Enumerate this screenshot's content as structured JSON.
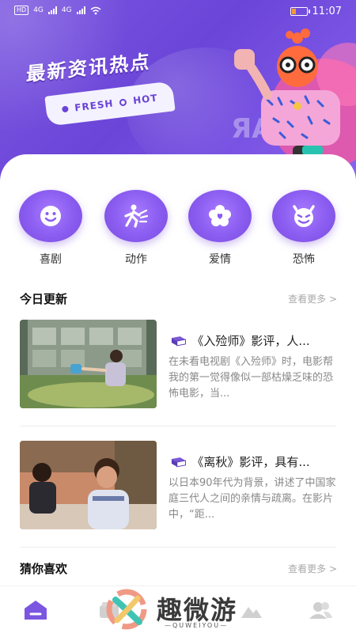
{
  "status_bar": {
    "hd_label": "HD",
    "network_a": "4G",
    "network_b": "4G",
    "time": "11:07"
  },
  "hero": {
    "title": "最新资讯热点",
    "tag_left": "FRESH",
    "tag_right": "HOT"
  },
  "categories": [
    {
      "label": "喜剧",
      "icon": "smile-icon"
    },
    {
      "label": "动作",
      "icon": "running-icon"
    },
    {
      "label": "爱情",
      "icon": "flower-heart-icon"
    },
    {
      "label": "恐怖",
      "icon": "devil-icon"
    }
  ],
  "today_section": {
    "title": "今日更新",
    "more": "查看更多 >"
  },
  "articles": [
    {
      "title": "《入殓师》影评，人...",
      "desc": "在未看电视剧《入殓师》时，电影帮我的第一觉得像似一部枯燥乏味的恐怖电影，当..."
    },
    {
      "title": "《离秋》影评，具有...",
      "desc": "以日本90年代为背景，讲述了中国家庭三代人之间的亲情与疏离。在影片中，“距..."
    }
  ],
  "guess_section": {
    "title": "猜你喜欢",
    "more": "查看更多 >"
  },
  "watermark": {
    "text": "趣微游",
    "sub": "—QUWEIYOU—"
  },
  "colors": {
    "primary": "#7b56e0",
    "text_dark": "#222222",
    "text_muted": "#888888"
  }
}
